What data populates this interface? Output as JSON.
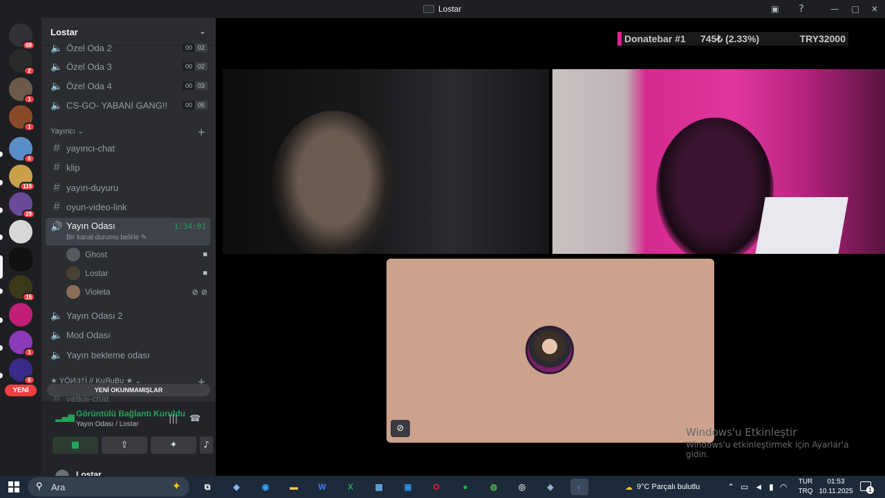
{
  "window": {
    "title": "Lostar"
  },
  "rail": {
    "badges": [
      "69",
      "2",
      "1",
      "1",
      "6",
      "119",
      "29",
      "15",
      "1",
      "6"
    ],
    "new_label": "YENİ"
  },
  "sidebar": {
    "guild_name": "Lostar",
    "voice_channels_top": [
      {
        "label": "Özel Oda 2",
        "c1": "00",
        "c2": "02"
      },
      {
        "label": "Özel Oda 3",
        "c1": "00",
        "c2": "02"
      },
      {
        "label": "Özel Oda 4",
        "c1": "00",
        "c2": "03"
      },
      {
        "label": "CS-GO- YABANİ GANG!!",
        "c1": "00",
        "c2": "05"
      }
    ],
    "category_yayinci": "Yayıncı",
    "text_channels": [
      "yayıncı-chat",
      "klip",
      "yayın-duyuru",
      "oyun-video-link"
    ],
    "active_channel": {
      "label": "Yayın Odası",
      "timer": "1:34:01",
      "status": "Bir kanal durumu belirle"
    },
    "voice_users": [
      "Ghost",
      "Lostar",
      "Violeta"
    ],
    "voice_channels_bottom": [
      "Yayın Odası 2",
      "Mod Odası",
      "Yayın bekleme odası"
    ],
    "category_yonetici": "★ YÖИ૩†İ // KuЯuBu ★",
    "partial_channel": "yetkili-chat",
    "unread_label": "YENİ OKUNMAMIŞLAR"
  },
  "voice_panel": {
    "status": "Görüntülü Bağlantı Kuruldu",
    "location": "Yayın Odası / Lostar",
    "user_name": "Lostar"
  },
  "stage": {
    "donate_name": "Donatebar #1",
    "donate_value": "745₺ (2.33%)",
    "donate_goal": "TRY32000",
    "watermark_title": "Windows'u Etkinleştir",
    "watermark_sub": "Windows'u etkinleştirmek için Ayarlar'a gidin."
  },
  "taskbar": {
    "search_placeholder": "Ara",
    "weather": "9°C  Parçalı bulutlu",
    "lang1": "TUR",
    "lang2": "TRQ",
    "time": "01:53",
    "date": "10.11.2025",
    "notif_count": "1"
  }
}
